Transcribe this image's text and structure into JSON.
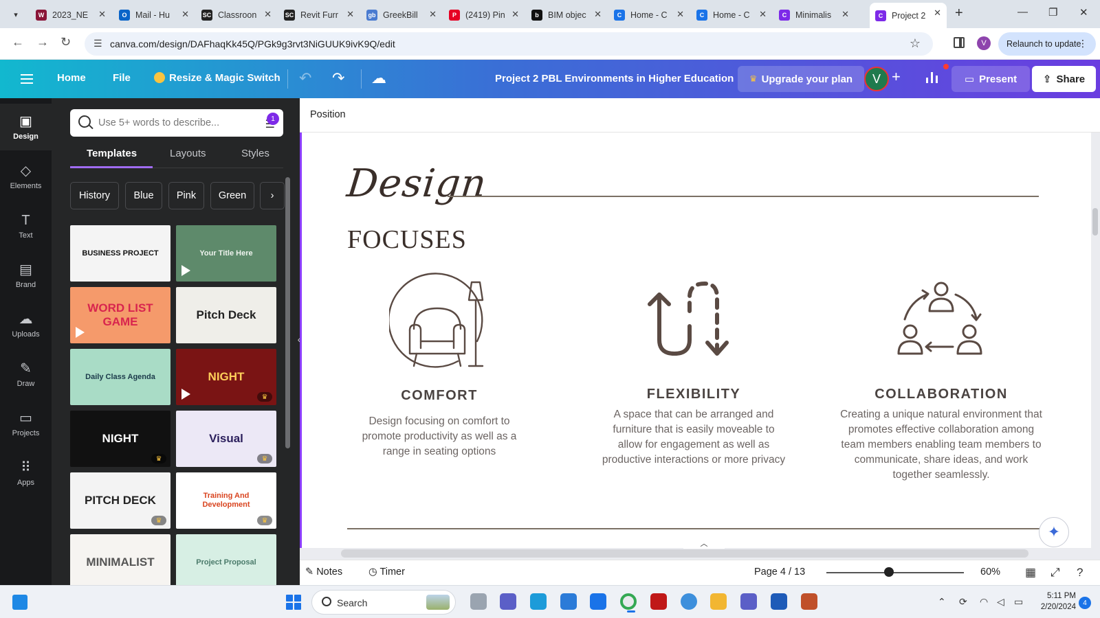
{
  "browser": {
    "tabs": [
      {
        "title": "2023_NE",
        "color": "#8a1538",
        "glyph": "W"
      },
      {
        "title": "Mail - Hu",
        "color": "#0a64c8",
        "glyph": "O"
      },
      {
        "title": "Classroon",
        "color": "#222222",
        "glyph": "SC"
      },
      {
        "title": "Revit Furr",
        "color": "#222222",
        "glyph": "SC"
      },
      {
        "title": "GreekBill",
        "color": "#4a7bd0",
        "glyph": "gb"
      },
      {
        "title": "(2419) Pin",
        "color": "#e60023",
        "glyph": "P"
      },
      {
        "title": "BIM objec",
        "color": "#111111",
        "glyph": "b"
      },
      {
        "title": "Home - C",
        "color": "#1a73e8",
        "glyph": "C"
      },
      {
        "title": "Home - C",
        "color": "#1a73e8",
        "glyph": "C"
      },
      {
        "title": "Minimalis",
        "color": "#7d2ae8",
        "glyph": "C"
      }
    ],
    "active_tab": {
      "title": "Project 2",
      "color": "#7d2ae8",
      "glyph": "C"
    },
    "url": "canva.com/design/DAFhaqKk45Q/PGk9g3rvt3NiGUUK9ivK9Q/edit",
    "relaunch_label": "Relaunch to update",
    "profile_initial": "V"
  },
  "header": {
    "home": "Home",
    "file": "File",
    "magic": "Resize & Magic Switch",
    "title": "Project 2 PBL Environments in Higher Education",
    "upgrade": "Upgrade your plan",
    "avatar": "V",
    "present": "Present",
    "share": "Share"
  },
  "rail": [
    {
      "label": "Design",
      "icon": "design-icon",
      "active": true
    },
    {
      "label": "Elements",
      "icon": "elements-icon"
    },
    {
      "label": "Text",
      "icon": "text-icon"
    },
    {
      "label": "Brand",
      "icon": "brand-icon"
    },
    {
      "label": "Uploads",
      "icon": "uploads-icon"
    },
    {
      "label": "Draw",
      "icon": "draw-icon"
    },
    {
      "label": "Projects",
      "icon": "projects-icon"
    },
    {
      "label": "Apps",
      "icon": "apps-icon"
    }
  ],
  "panel": {
    "search_placeholder": "Use 5+ words to describe...",
    "filter_badge": "1",
    "tabs": [
      "Templates",
      "Layouts",
      "Styles"
    ],
    "chips": [
      "History",
      "Blue",
      "Pink",
      "Green"
    ],
    "templates": [
      {
        "title": "BUSINESS PROJECT",
        "bg": "#f4f4f4",
        "fg": "#111111",
        "play": false,
        "premium": false
      },
      {
        "title": "Your Title Here",
        "bg": "#5e8a6b",
        "fg": "#eef3ee",
        "play": true,
        "premium": false
      },
      {
        "title": "WORD LIST GAME",
        "bg": "#f59a6b",
        "fg": "#d8244e",
        "play": true,
        "premium": false
      },
      {
        "title": "Pitch Deck",
        "bg": "#efeee9",
        "fg": "#222222",
        "play": false,
        "premium": false
      },
      {
        "title": "Daily Class Agenda",
        "bg": "#a9dcc6",
        "fg": "#1b3a4a",
        "play": false,
        "premium": false
      },
      {
        "title": "NIGHT",
        "bg": "#7a1414",
        "fg": "#ffcf5a",
        "play": true,
        "premium": true
      },
      {
        "title": "NIGHT",
        "bg": "#111111",
        "fg": "#ffffff",
        "play": false,
        "premium": true
      },
      {
        "title": "Visual",
        "bg": "#ece8f6",
        "fg": "#2b1f5c",
        "play": false,
        "premium": true
      },
      {
        "title": "PITCH DECK",
        "bg": "#f3f3f3",
        "fg": "#222222",
        "play": false,
        "premium": true
      },
      {
        "title": "Training And Development",
        "bg": "#ffffff",
        "fg": "#d9441f",
        "play": false,
        "premium": true
      },
      {
        "title": "MINIMALIST",
        "bg": "#f6f4f1",
        "fg": "#555555",
        "play": false,
        "premium": false
      },
      {
        "title": "Project Proposal",
        "bg": "#d7efe4",
        "fg": "#4a7a6a",
        "play": false,
        "premium": false
      }
    ]
  },
  "editor": {
    "context_label": "Position",
    "slide": {
      "script_title": "Design",
      "caps_title": "FOCUSES",
      "focuses": [
        {
          "title": "COMFORT",
          "desc": "Design focusing on comfort to promote productivity as well as a range in seating options",
          "icon": "armchair-lamp-icon"
        },
        {
          "title": "FLEXIBILITY",
          "desc": "A space that can be arranged and furniture that is easily moveable to allow for engagement as well as productive interactions or more privacy",
          "icon": "flexible-arrows-icon"
        },
        {
          "title": "COLLABORATION",
          "desc": "Creating a unique natural environment that promotes effective collaboration among team members enabling team members to communicate, share ideas, and work together seamlessly.",
          "icon": "team-cycle-icon"
        }
      ]
    }
  },
  "bottombar": {
    "notes": "Notes",
    "timer": "Timer",
    "page": "Page 4 / 13",
    "zoom": "60%"
  },
  "taskbar": {
    "search": "Search",
    "time": "5:11 PM",
    "date": "2/20/2024",
    "notifications": "4"
  }
}
